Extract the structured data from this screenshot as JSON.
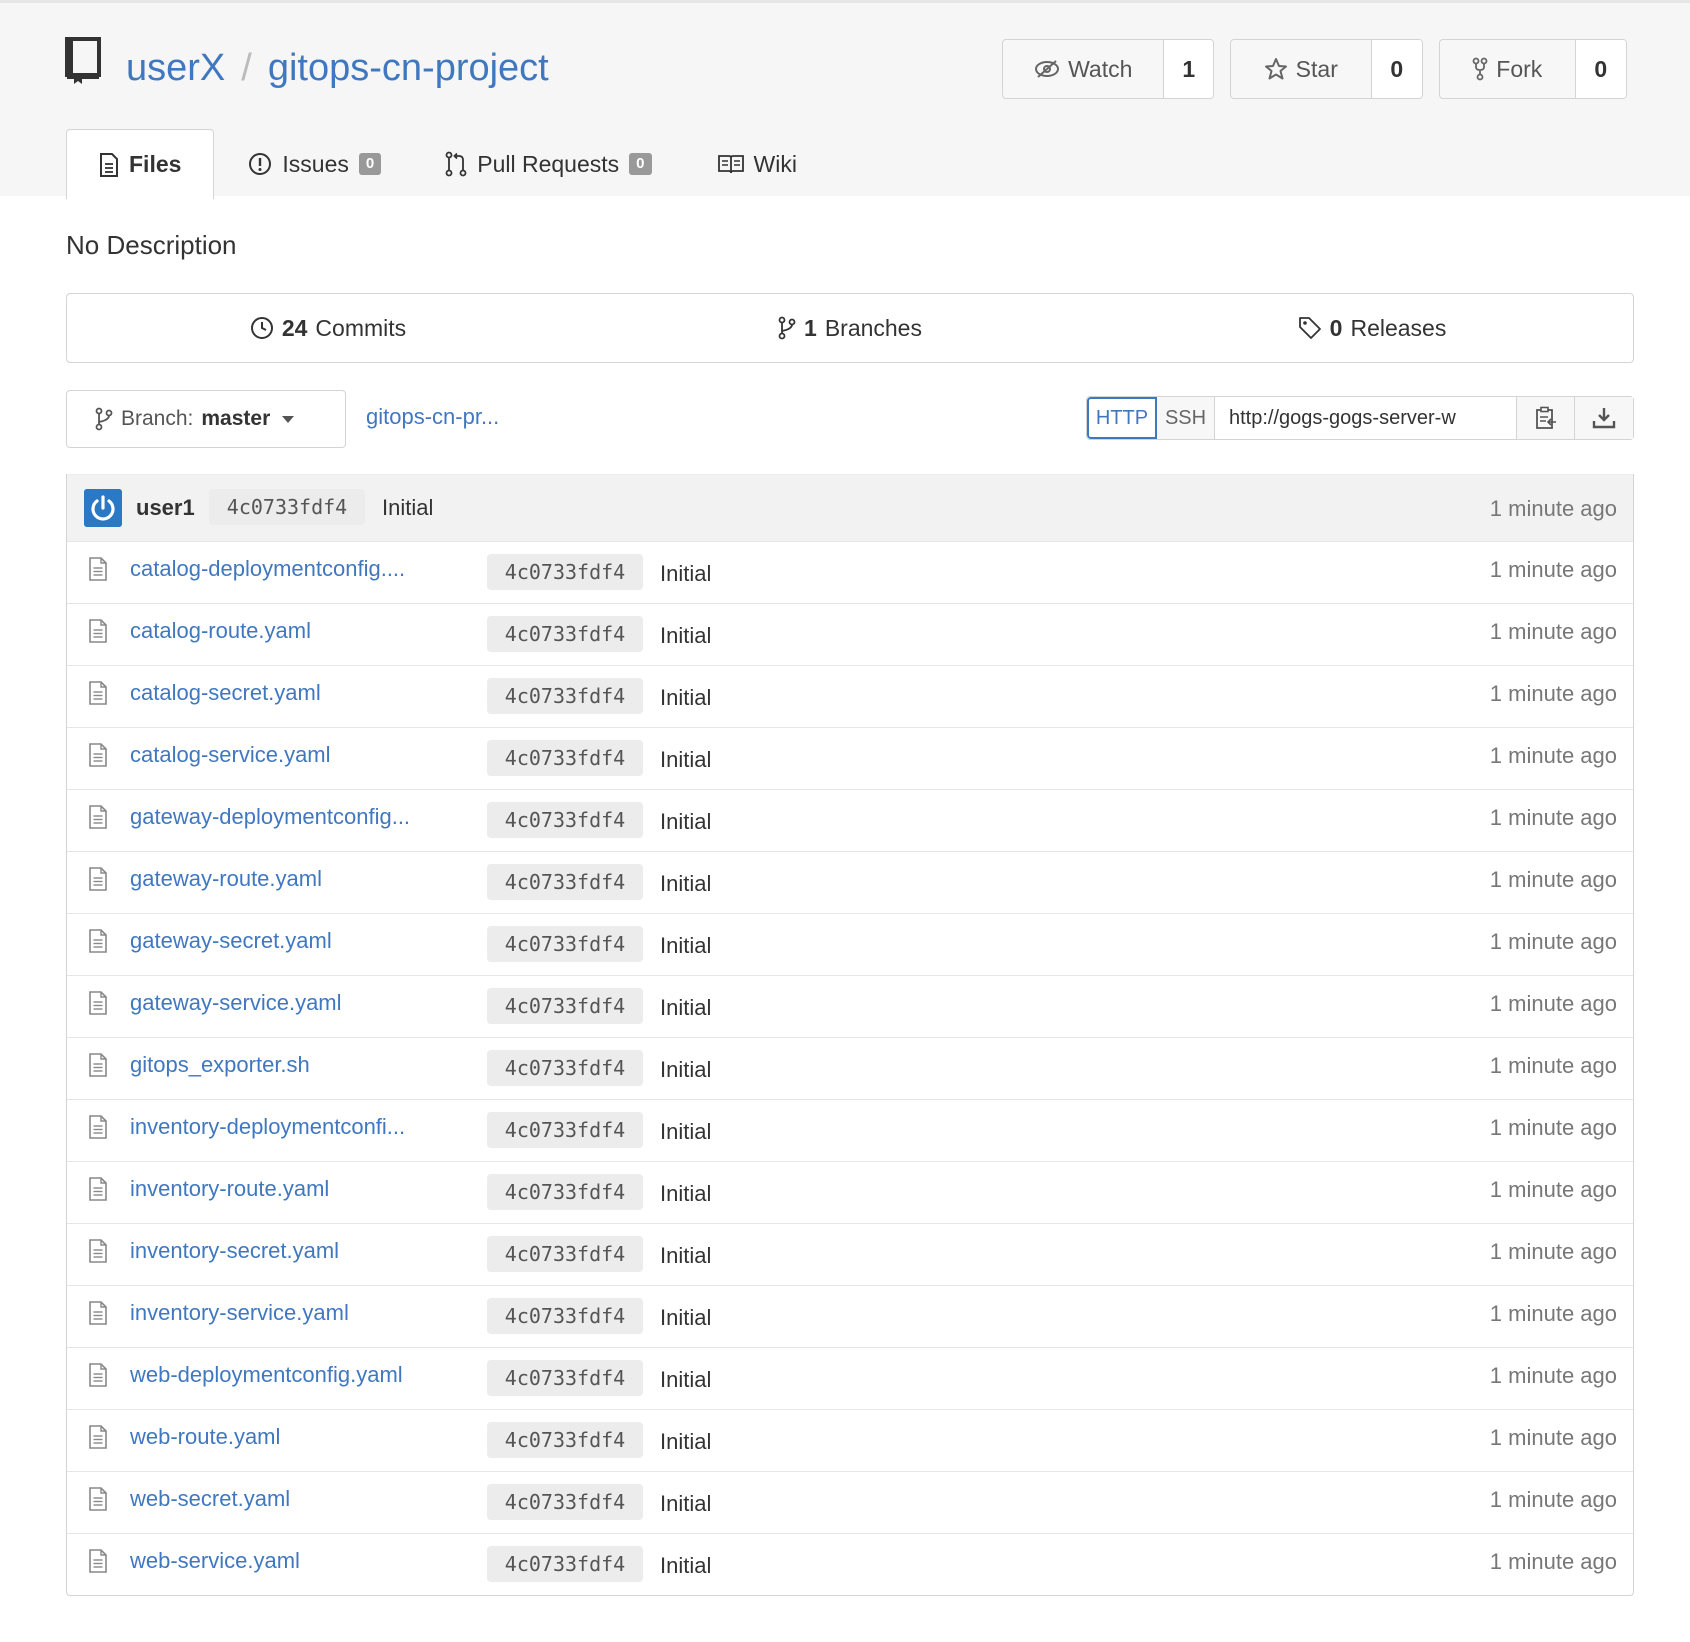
{
  "repo": {
    "owner": "userX",
    "separator": "/",
    "name": "gitops-cn-project",
    "description": "No Description"
  },
  "actions": {
    "watch_label": "Watch",
    "watch_count": "1",
    "star_label": "Star",
    "star_count": "0",
    "fork_label": "Fork",
    "fork_count": "0"
  },
  "tabs": {
    "files": "Files",
    "issues": "Issues",
    "issues_count": "0",
    "pulls": "Pull Requests",
    "pulls_count": "0",
    "wiki": "Wiki"
  },
  "stats": {
    "commits_count": "24",
    "commits_label": "Commits",
    "branches_count": "1",
    "branches_label": "Branches",
    "releases_count": "0",
    "releases_label": "Releases"
  },
  "branch": {
    "prefix": "Branch:",
    "name": "master",
    "breadcrumb": "gitops-cn-pr..."
  },
  "clone": {
    "http_label": "HTTP",
    "ssh_label": "SSH",
    "url": "http://gogs-gogs-server-w"
  },
  "latest_commit": {
    "user": "user1",
    "sha": "4c0733fdf4",
    "message": "Initial",
    "time": "1 minute ago"
  },
  "colors": {
    "link": "#4078c0",
    "avatar": "#2b78c5"
  },
  "files": [
    {
      "name": "catalog-deploymentconfig....",
      "sha": "4c0733fdf4",
      "message": "Initial",
      "time": "1 minute ago"
    },
    {
      "name": "catalog-route.yaml",
      "sha": "4c0733fdf4",
      "message": "Initial",
      "time": "1 minute ago"
    },
    {
      "name": "catalog-secret.yaml",
      "sha": "4c0733fdf4",
      "message": "Initial",
      "time": "1 minute ago"
    },
    {
      "name": "catalog-service.yaml",
      "sha": "4c0733fdf4",
      "message": "Initial",
      "time": "1 minute ago"
    },
    {
      "name": "gateway-deploymentconfig...",
      "sha": "4c0733fdf4",
      "message": "Initial",
      "time": "1 minute ago"
    },
    {
      "name": "gateway-route.yaml",
      "sha": "4c0733fdf4",
      "message": "Initial",
      "time": "1 minute ago"
    },
    {
      "name": "gateway-secret.yaml",
      "sha": "4c0733fdf4",
      "message": "Initial",
      "time": "1 minute ago"
    },
    {
      "name": "gateway-service.yaml",
      "sha": "4c0733fdf4",
      "message": "Initial",
      "time": "1 minute ago"
    },
    {
      "name": "gitops_exporter.sh",
      "sha": "4c0733fdf4",
      "message": "Initial",
      "time": "1 minute ago"
    },
    {
      "name": "inventory-deploymentconfi...",
      "sha": "4c0733fdf4",
      "message": "Initial",
      "time": "1 minute ago"
    },
    {
      "name": "inventory-route.yaml",
      "sha": "4c0733fdf4",
      "message": "Initial",
      "time": "1 minute ago"
    },
    {
      "name": "inventory-secret.yaml",
      "sha": "4c0733fdf4",
      "message": "Initial",
      "time": "1 minute ago"
    },
    {
      "name": "inventory-service.yaml",
      "sha": "4c0733fdf4",
      "message": "Initial",
      "time": "1 minute ago"
    },
    {
      "name": "web-deploymentconfig.yaml",
      "sha": "4c0733fdf4",
      "message": "Initial",
      "time": "1 minute ago"
    },
    {
      "name": "web-route.yaml",
      "sha": "4c0733fdf4",
      "message": "Initial",
      "time": "1 minute ago"
    },
    {
      "name": "web-secret.yaml",
      "sha": "4c0733fdf4",
      "message": "Initial",
      "time": "1 minute ago"
    },
    {
      "name": "web-service.yaml",
      "sha": "4c0733fdf4",
      "message": "Initial",
      "time": "1 minute ago"
    }
  ]
}
